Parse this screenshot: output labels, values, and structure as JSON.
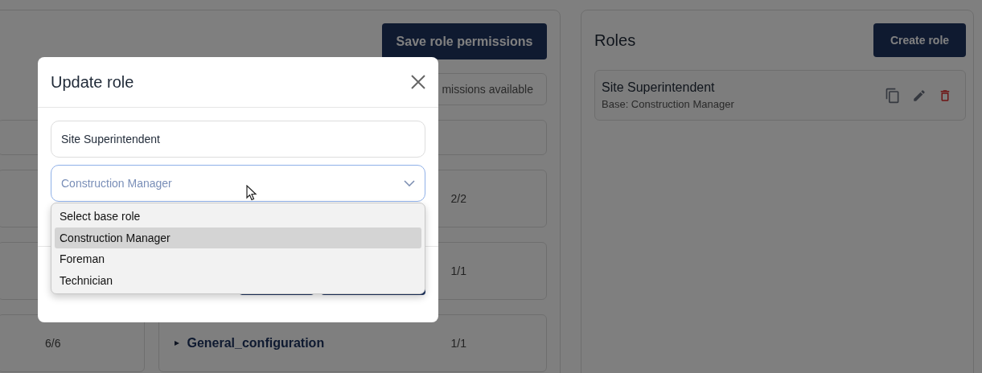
{
  "permissions": {
    "save_button": "Save role permissions",
    "note": "missions available",
    "left_cards": [
      {
        "kind": "short"
      },
      {
        "kind": "tall"
      },
      {
        "kind": "tall"
      },
      {
        "kind": "tall",
        "count": "6/6"
      }
    ],
    "main_cards": [
      {
        "kind": "short"
      },
      {
        "kind": "tall",
        "count": "2/2"
      },
      {
        "kind": "tall",
        "count": "1/1"
      },
      {
        "kind": "tall",
        "title": "General_configuration",
        "count": "1/1",
        "expanded": false
      }
    ]
  },
  "roles_panel": {
    "title": "Roles",
    "create_button": "Create role",
    "roles": [
      {
        "name": "Site Superintendent",
        "base": "Base: Construction Manager"
      }
    ]
  },
  "modal": {
    "title": "Update role",
    "name_field": {
      "value": "Site Superintendent"
    },
    "base_select": {
      "value": "Construction Manager",
      "open": true
    },
    "options": [
      {
        "label": "Select base role",
        "selected": false
      },
      {
        "label": "Construction Manager",
        "selected": true
      },
      {
        "label": "Foreman",
        "selected": false
      },
      {
        "label": "Technician",
        "selected": false
      }
    ]
  }
}
